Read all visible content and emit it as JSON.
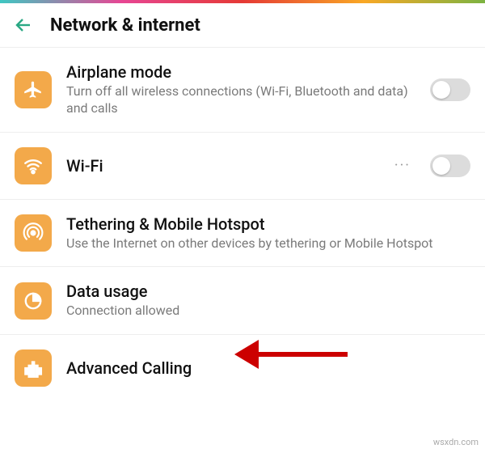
{
  "header": {
    "title": "Network & internet"
  },
  "rows": {
    "airplane": {
      "title": "Airplane mode",
      "sub": "Turn off all wireless connections (Wi-Fi, Bluetooth and data) and calls"
    },
    "wifi": {
      "title": "Wi-Fi",
      "more": "···"
    },
    "tethering": {
      "title": "Tethering & Mobile Hotspot",
      "sub": "Use the Internet on other devices by tethering or Mobile Hotspot"
    },
    "data_usage": {
      "title": "Data usage",
      "sub": "Connection allowed"
    },
    "advanced_calling": {
      "title": "Advanced Calling"
    }
  },
  "watermark": "wsxdn.com",
  "colors": {
    "accent_icon": "#f3a94a",
    "back_arrow": "#2aa884",
    "pointer": "#cc0000"
  }
}
